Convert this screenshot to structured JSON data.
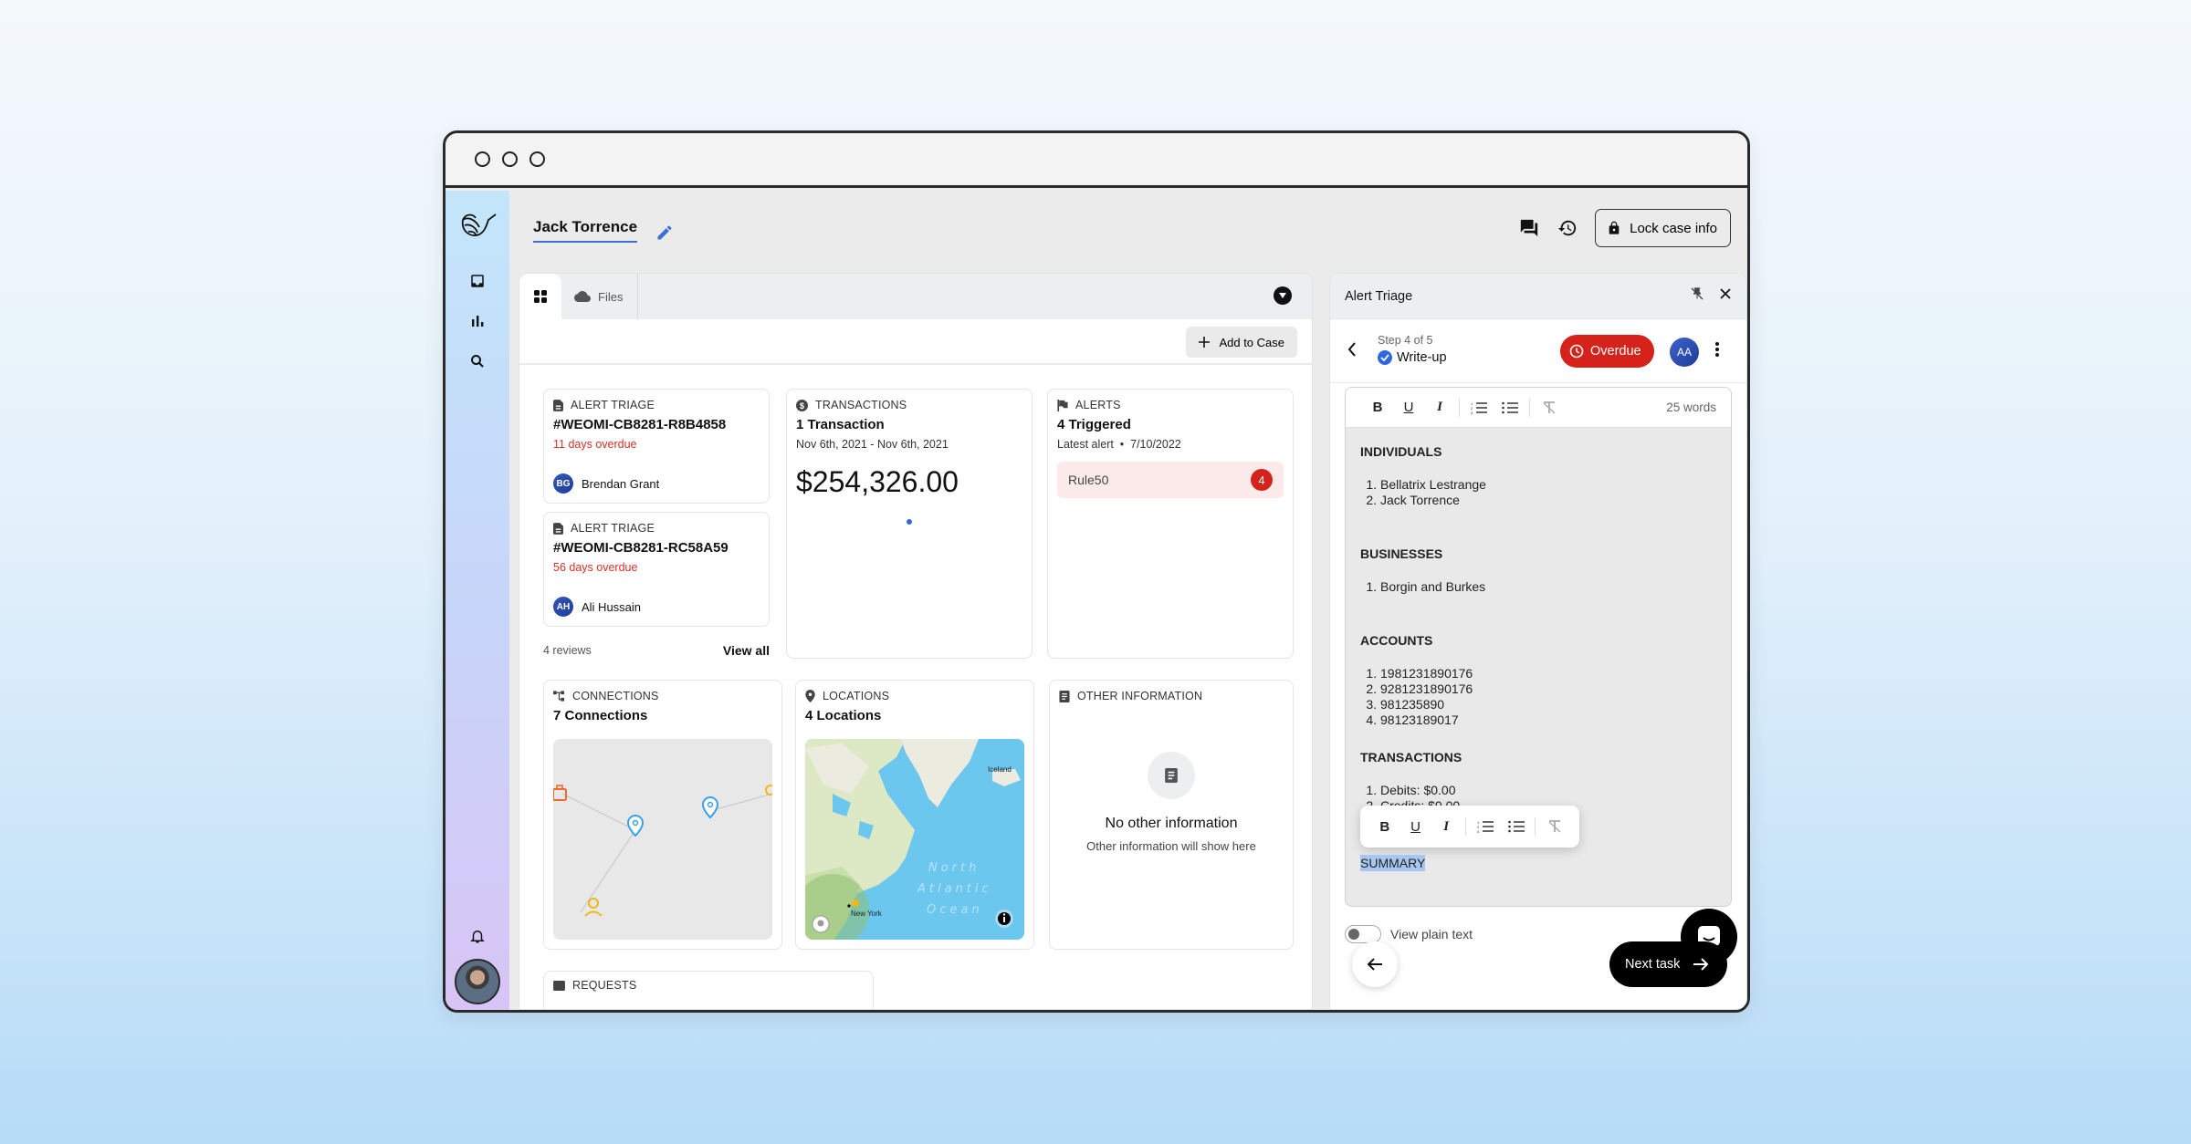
{
  "window": {
    "traffic_lights": [
      "close",
      "minimize",
      "maximize"
    ]
  },
  "sidebar": {
    "logo": "hummingbird-logo",
    "items": [
      {
        "name": "inbox",
        "icon": "inbox-icon"
      },
      {
        "name": "analytics",
        "icon": "bar-chart-icon"
      },
      {
        "name": "search",
        "icon": "search-icon"
      }
    ],
    "bottom": [
      {
        "name": "notifications",
        "icon": "bell-icon"
      },
      {
        "name": "user-avatar",
        "icon": "avatar"
      }
    ]
  },
  "header": {
    "case_name": "Jack Torrence",
    "actions": {
      "comments_icon": "comments-icon",
      "history_icon": "history-icon",
      "lock_label": "Lock case info"
    }
  },
  "main": {
    "tabs": [
      {
        "label": "",
        "icon": "grid-icon",
        "active": true
      },
      {
        "label": "Files",
        "icon": "cloud-icon",
        "active": false
      }
    ],
    "add_to_case_label": "Add to Case",
    "alert_triage_cards": [
      {
        "kicker": "ALERT TRIAGE",
        "id": "#WEOMI-CB8281-R8B4858",
        "overdue": "11 days overdue",
        "assignee_initials": "BG",
        "assignee": "Brendan Grant"
      },
      {
        "kicker": "ALERT TRIAGE",
        "id": "#WEOMI-CB8281-RC58A59",
        "overdue": "56 days overdue",
        "assignee_initials": "AH",
        "assignee": "Ali Hussain"
      }
    ],
    "reviews_count": "4 reviews",
    "view_all_label": "View all",
    "transactions": {
      "kicker": "TRANSACTIONS",
      "title": "1 Transaction",
      "date_range": "Nov 6th, 2021 - Nov 6th, 2021",
      "amount": "$254,326.00"
    },
    "alerts": {
      "kicker": "ALERTS",
      "title": "4 Triggered",
      "latest_label": "Latest alert",
      "latest_date": "7/10/2022",
      "rules": [
        {
          "name": "Rule50",
          "count": "4"
        }
      ]
    },
    "connections": {
      "kicker": "CONNECTIONS",
      "title": "7 Connections"
    },
    "locations": {
      "kicker": "LOCATIONS",
      "title": "4 Locations",
      "map_labels": {
        "iceland": "Iceland",
        "city": "New York",
        "ocean_line1": "North",
        "ocean_line2": "Atlantic",
        "ocean_line3": "Ocean"
      }
    },
    "other_information": {
      "kicker": "OTHER INFORMATION",
      "empty_title": "No other information",
      "empty_sub": "Other information will show here"
    },
    "requests": {
      "kicker": "REQUESTS"
    }
  },
  "right_panel": {
    "title": "Alert Triage",
    "step_label": "Step 4 of 5",
    "step_name": "Write-up",
    "status": "Overdue",
    "assignee_initials": "AA",
    "editor": {
      "toolbar": {
        "bold": "B",
        "underline": "U",
        "italic": "I"
      },
      "word_count": "25 words",
      "sections": [
        {
          "heading": "INDIVIDUALS",
          "items": [
            "Bellatrix Lestrange",
            "Jack Torrence"
          ]
        },
        {
          "heading": "BUSINESSES",
          "items": [
            "Borgin and Burkes"
          ]
        },
        {
          "heading": "ACCOUNTS",
          "items": [
            "1981231890176",
            "9281231890176",
            "981235890",
            "98123189017"
          ]
        },
        {
          "heading": "TRANSACTIONS",
          "items": [
            "Debits: $0.00",
            "Credits: $0.00"
          ]
        }
      ],
      "selected_text": "SUMMARY"
    },
    "plain_text_label": "View plain text",
    "plain_text_enabled": false,
    "next_task_label": "Next task"
  }
}
